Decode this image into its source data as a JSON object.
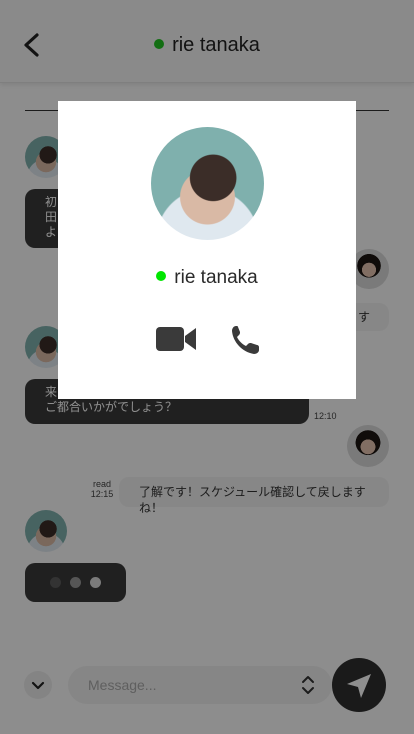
{
  "header": {
    "title": "rie tanaka",
    "status_color": "#22c522"
  },
  "messages": [
    {
      "from": "them",
      "type": "text",
      "lines": [
        "初",
        "田",
        "よ"
      ]
    },
    {
      "from": "me",
      "type": "text",
      "text": "す"
    },
    {
      "from": "them",
      "type": "text",
      "lines": [
        "来",
        "ご都合いかがでしょう？"
      ],
      "time": "12:10"
    },
    {
      "from": "me",
      "type": "text",
      "text": "了解です！スケジュール確認して戻しますね！",
      "read": "read",
      "time": "12:15"
    },
    {
      "from": "them",
      "type": "typing"
    }
  ],
  "typing_dot_colors": [
    "#5c5c5c",
    "#9a9a9a",
    "#dcdcdc"
  ],
  "composer": {
    "placeholder": "Message..."
  },
  "modal": {
    "name": "rie tanaka",
    "status_color": "#00e600",
    "actions": [
      {
        "icon": "video-camera-icon"
      },
      {
        "icon": "phone-icon"
      }
    ]
  },
  "icons": {
    "back": "chevron-left-icon",
    "scroll_down": "chevron-down-icon",
    "stepper": "up-down-chevron-icon",
    "send": "paper-plane-icon"
  },
  "colors": {
    "bubble_dark": "#3a3a3a",
    "bubble_light": "#f0f0f0",
    "overlay": "rgba(0,0,0,0.44)"
  }
}
